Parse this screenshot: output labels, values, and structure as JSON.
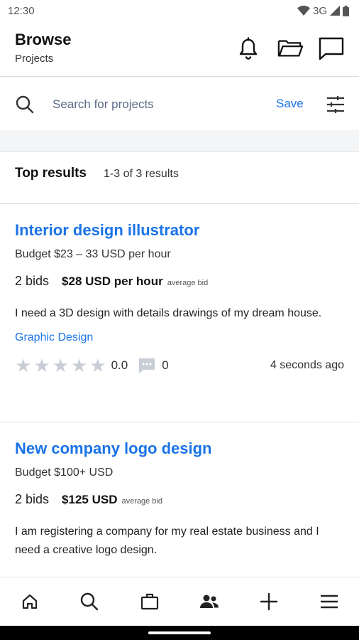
{
  "status_bar": {
    "time": "12:30",
    "network": "3G"
  },
  "app_bar": {
    "title": "Browse",
    "subtitle": "Projects",
    "icons": [
      "notification-bell-icon",
      "folder-icon",
      "chat-icon"
    ]
  },
  "search": {
    "placeholder": "Search for projects",
    "save_label": "Save"
  },
  "results": {
    "title": "Top results",
    "count": "1-3 of 3 results",
    "projects": [
      {
        "title": "Interior design illustrator",
        "budget": "Budget $23 – 33 USD per hour",
        "bids": "2 bids",
        "avg_bid_amount": "$28 USD per hour",
        "avg_bid_label": "average bid",
        "description": "I need a 3D design with details drawings of my dream house.",
        "category": "Graphic Design",
        "rating": "0.0",
        "comments": "0",
        "posted": "4 seconds ago"
      },
      {
        "title": "New company logo design",
        "budget": "Budget $100+ USD",
        "bids": "2 bids",
        "avg_bid_amount": "$125 USD",
        "avg_bid_label": "average bid",
        "description": "I am registering a company for my real estate business and I need a creative logo design."
      }
    ]
  },
  "bottom_nav": [
    "home-icon",
    "search-icon",
    "briefcase-icon",
    "people-icon",
    "add-icon",
    "menu-icon"
  ],
  "colors": {
    "accent": "#1a73e8",
    "background": "#f4f5f6",
    "star": "#c8cdd6"
  }
}
